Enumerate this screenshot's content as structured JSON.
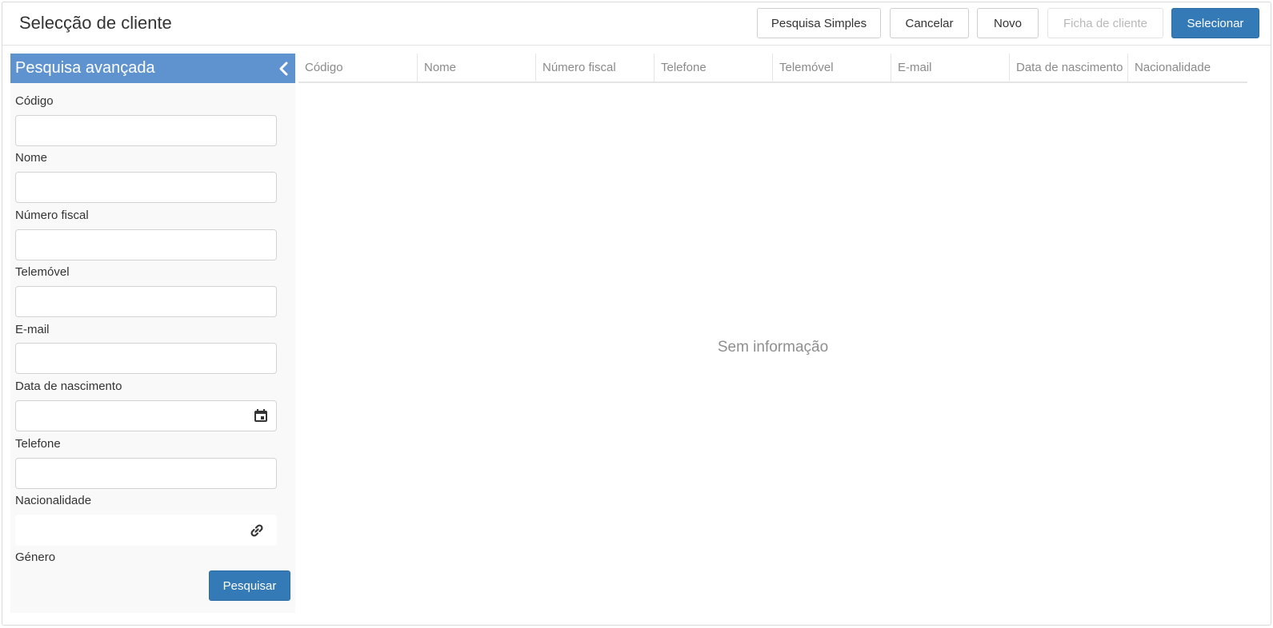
{
  "header": {
    "title": "Selecção de cliente",
    "buttons": {
      "simple_search": "Pesquisa Simples",
      "cancel": "Cancelar",
      "new": "Novo",
      "client_record": "Ficha de cliente",
      "select": "Selecionar"
    }
  },
  "sidebar": {
    "title": "Pesquisa avançada",
    "fields": {
      "code": "Código",
      "name": "Nome",
      "tax_number": "Número fiscal",
      "mobile": "Telemóvel",
      "email": "E-mail",
      "birth_date": "Data de nascimento",
      "phone": "Telefone",
      "nationality": "Nacionalidade",
      "gender": "Género"
    },
    "search_button": "Pesquisar"
  },
  "grid": {
    "columns": [
      "Código",
      "Nome",
      "Número fiscal",
      "Telefone",
      "Telemóvel",
      "E-mail",
      "Data de nascimento",
      "Nacionalidade"
    ],
    "empty_message": "Sem informação"
  },
  "icons": {
    "collapse": "chevron-left-icon",
    "calendar": "calendar-icon",
    "link": "link-icon"
  },
  "colors": {
    "primary": "#337ab7",
    "sidebar_header": "#5f93cf"
  }
}
